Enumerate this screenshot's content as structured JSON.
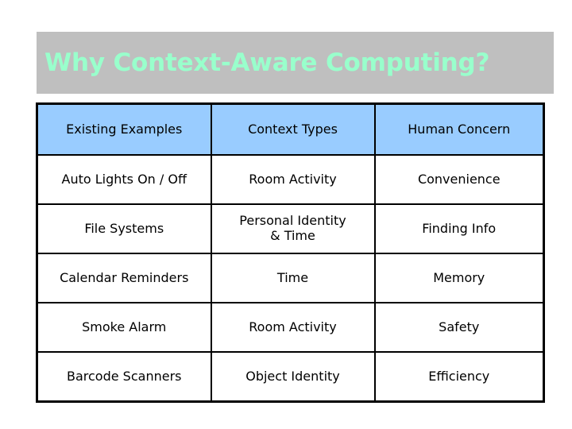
{
  "slide": {
    "title": "Why Context-Aware Computing?",
    "title_color": "#99ffcc",
    "title_band_color": "#bfbfbf",
    "background_color": "#ffffff"
  },
  "table": {
    "header_background": "#99ccff",
    "border_color": "#000000",
    "columns": [
      "Existing Examples",
      "Context Types",
      "Human Concern"
    ],
    "rows": [
      {
        "example": "Auto Lights On / Off",
        "context_type_line1": "Room Activity",
        "context_type_line2": "",
        "human_concern": "Convenience"
      },
      {
        "example": "File Systems",
        "context_type_line1": "Personal Identity",
        "context_type_line2": "& Time",
        "human_concern": "Finding Info"
      },
      {
        "example": "Calendar Reminders",
        "context_type_line1": "Time",
        "context_type_line2": "",
        "human_concern": "Memory"
      },
      {
        "example": "Smoke Alarm",
        "context_type_line1": "Room Activity",
        "context_type_line2": "",
        "human_concern": "Safety"
      },
      {
        "example": "Barcode Scanners",
        "context_type_line1": "Object Identity",
        "context_type_line2": "",
        "human_concern": "Efficiency"
      }
    ]
  }
}
